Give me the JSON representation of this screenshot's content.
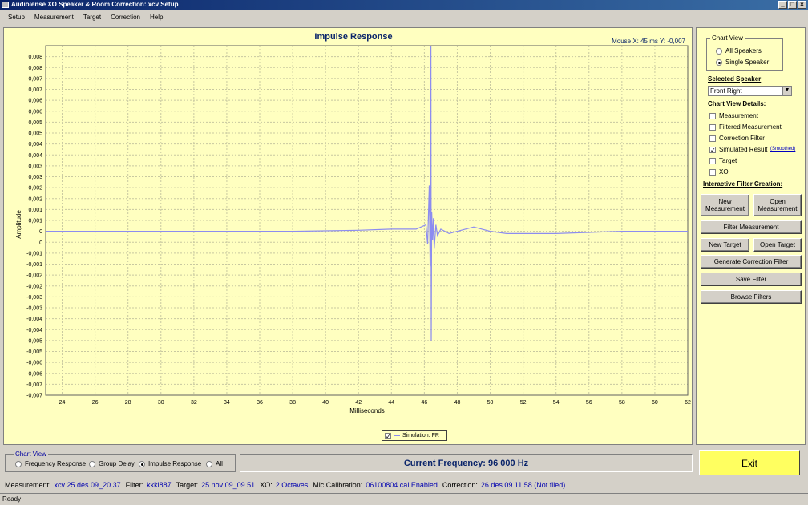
{
  "window": {
    "title": "Audiolense XO Speaker & Room Correction: xcv Setup",
    "min": "_",
    "max": "□",
    "close": "×"
  },
  "menu": [
    "Setup",
    "Measurement",
    "Target",
    "Correction",
    "Help"
  ],
  "chart": {
    "mouse_readout": "Mouse X: 45 ms   Y: -0,007",
    "legend_label": "Simulation: FR",
    "colors": {
      "line": "#8c8cf0",
      "grid": "#c8c8a0",
      "axis_text": "#000000",
      "title": "#0a246a"
    }
  },
  "chart_data": {
    "type": "line",
    "title": "Impulse Response",
    "xlabel": "Milliseconds",
    "ylabel": "Amplitude",
    "xlim": [
      23,
      62
    ],
    "ylim": [
      -0.0075,
      0.0085
    ],
    "x_ticks": [
      "24",
      "26",
      "28",
      "30",
      "32",
      "34",
      "36",
      "38",
      "40",
      "42",
      "44",
      "46",
      "48",
      "50",
      "52",
      "54",
      "56",
      "58",
      "60",
      "62"
    ],
    "y_ticks": [
      "0,008",
      "0,008",
      "0,007",
      "0,007",
      "0,006",
      "0,006",
      "0,005",
      "0,005",
      "0,004",
      "0,004",
      "0,003",
      "0,003",
      "0,002",
      "0,002",
      "0,001",
      "0,001",
      "0",
      "0",
      "-0,001",
      "-0,001",
      "-0,002",
      "-0,002",
      "-0,003",
      "-0,003",
      "-0,004",
      "-0,004",
      "-0,005",
      "-0,005",
      "-0,006",
      "-0,006",
      "-0,007",
      "-0,007"
    ],
    "grid": true,
    "legend": "bottom-center",
    "series": [
      {
        "name": "Simulation: FR",
        "x": [
          23,
          30,
          38,
          42,
          44,
          45.5,
          46.1,
          46.2,
          46.3,
          46.35,
          46.4,
          46.42,
          46.45,
          46.5,
          46.55,
          46.6,
          46.7,
          46.8,
          47,
          47.5,
          48,
          49,
          49.5,
          50,
          51,
          54,
          58,
          62
        ],
        "y": [
          0,
          0,
          0,
          5e-05,
          0.0001,
          0.0001,
          0.0003,
          -0.0006,
          0.0021,
          -0.0016,
          0.0085,
          -0.005,
          0.0009,
          -0.0004,
          0.0006,
          -0.0008,
          0.0003,
          -0.0002,
          0.0001,
          -0.0001,
          0,
          0.0002,
          0.0001,
          0,
          -0.0001,
          -0.0001,
          0,
          0
        ]
      }
    ]
  },
  "side": {
    "chart_view": {
      "title": "Chart View",
      "all_speakers": "All Speakers",
      "single_speaker": "Single Speaker"
    },
    "selected_speaker_label": "Selected Speaker",
    "selected_speaker_value": "Front Right",
    "details_title": "Chart View Details:",
    "details": [
      {
        "label": "Measurement",
        "checked": false
      },
      {
        "label": "Filtered Measurement",
        "checked": false
      },
      {
        "label": "Correction Filter",
        "checked": false
      },
      {
        "label": "Simulated Result",
        "checked": true
      },
      {
        "label": "Target",
        "checked": false
      },
      {
        "label": "XO",
        "checked": false
      }
    ],
    "smoothed": "(Smoothed)",
    "interactive_title": "Interactive Filter Creation:",
    "buttons": {
      "new_measurement": "New\nMeasurement",
      "open_measurement": "Open\nMeasurement",
      "filter_measurement": "Filter Measurement",
      "new_target": "New Target",
      "open_target": "Open Target",
      "generate_filter": "Generate Correction Filter",
      "save_filter": "Save Filter",
      "browse_filters": "Browse Filters"
    }
  },
  "bottom": {
    "chart_view_title": "Chart View",
    "options": [
      "Frequency Response",
      "Group Delay",
      "Impulse Response",
      "All"
    ],
    "selected": "Impulse Response",
    "frequency": "Current Frequency: 96 000 Hz",
    "exit": "Exit"
  },
  "info": {
    "measurement_label": "Measurement:",
    "measurement": "xcv 25 des 09_20 37",
    "filter_label": "Filter:",
    "filter": "kkkl887",
    "target_label": "Target:",
    "target": "25 nov 09_09 51",
    "xo_label": "XO:",
    "xo": "2 Octaves",
    "mic_label": "Mic Calibration:",
    "mic": "06100804.cal Enabled",
    "correction_label": "Correction:",
    "correction": "26.des.09 11:58 (Not filed)"
  },
  "status": "Ready"
}
